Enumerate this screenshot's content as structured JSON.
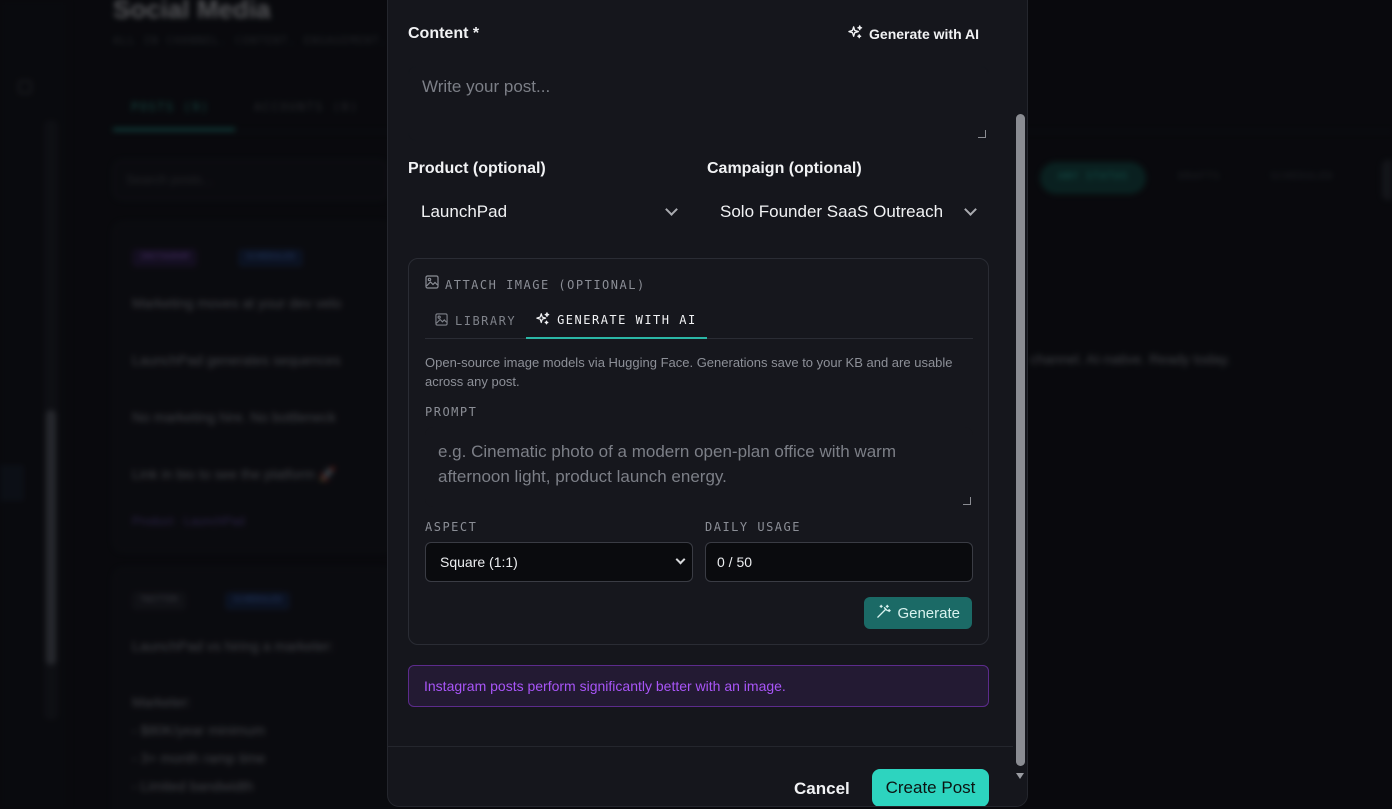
{
  "background": {
    "page_title": "Social Media",
    "page_subtitle": "ALL IN CHANNEL. CONTENT. ENGAGEMENT.",
    "tabs": [
      {
        "label": "POSTS (9)"
      },
      {
        "label": "ACCOUNTS (0)"
      }
    ],
    "search_placeholder": "Search posts...",
    "filters": [
      {
        "label": "ANY STATUS"
      },
      {
        "label": "DRAFTS"
      },
      {
        "label": "SCHEDULED"
      }
    ],
    "card1": {
      "chips": [
        "INSTAGRAM",
        "SCHEDULED"
      ],
      "lines": [
        "Marketing moves at your dev velo",
        "LaunchPad generates sequences",
        "No marketing hire. No bottleneck",
        "Link in bio to see the platform 🚀"
      ],
      "right_line": "channel. AI-native. Ready today.",
      "footer": "Product · LaunchPad"
    },
    "card2": {
      "chips": [
        "TWITTER",
        "SCHEDULED"
      ],
      "lines": [
        "LaunchPad vs hiring a marketer:",
        "Marketer:",
        "- $80K/year minimum",
        "- 3+ month ramp time",
        "- Limited bandwidth"
      ]
    }
  },
  "modal": {
    "content": {
      "label": "Content *",
      "generate_ai_label": "Generate with AI",
      "placeholder": "Write your post..."
    },
    "product": {
      "label": "Product (optional)",
      "value": "LaunchPad"
    },
    "campaign": {
      "label": "Campaign (optional)",
      "value": "Solo Founder SaaS Outreach"
    },
    "attach": {
      "title": "ATTACH IMAGE (OPTIONAL)",
      "tabs": [
        {
          "label": "LIBRARY"
        },
        {
          "label": "GENERATE WITH AI"
        }
      ],
      "description": "Open-source image models via Hugging Face. Generations save to your KB and are usable across any post.",
      "prompt_label": "PROMPT",
      "prompt_placeholder": "e.g. Cinematic photo of a modern open-plan office with warm afternoon light, product launch energy.",
      "aspect_label": "ASPECT",
      "aspect_value": "Square (1:1)",
      "usage_label": "DAILY USAGE",
      "usage_value": "0 / 50",
      "generate_label": "Generate"
    },
    "notice": "Instagram posts perform significantly better with an image.",
    "cancel_label": "Cancel",
    "create_label": "Create Post"
  },
  "colors": {
    "accent": "#2dd4bf",
    "notice_text": "#a855f7",
    "modal_bg": "#15161c"
  }
}
